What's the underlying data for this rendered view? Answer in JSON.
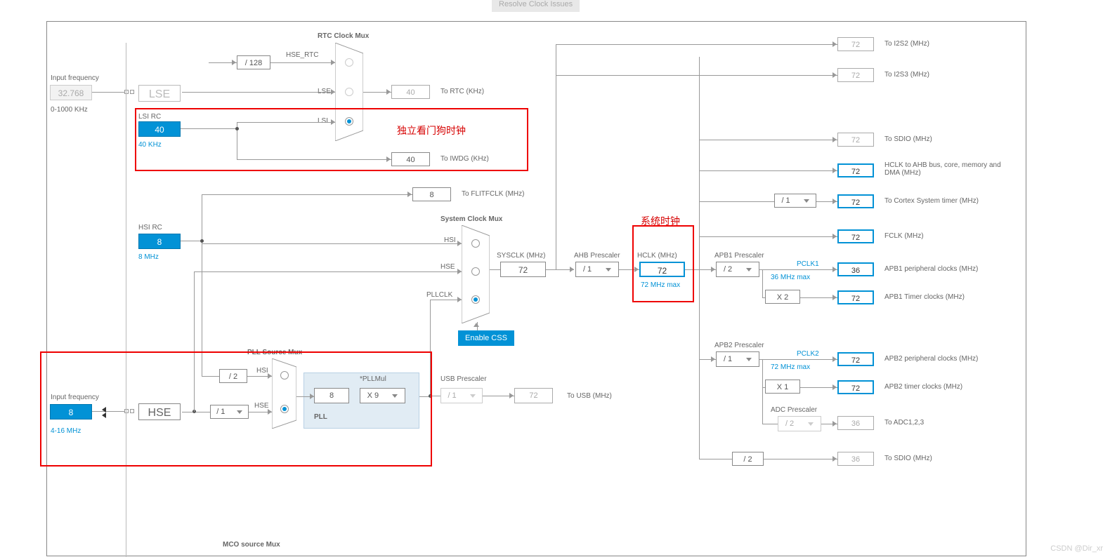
{
  "toolbar": {
    "resolve": "Resolve Clock Issues"
  },
  "input_freq_lse_label": "Input frequency",
  "input_freq_lse_value": "32.768",
  "input_freq_lse_range": "0-1000 KHz",
  "input_freq_hse_label": "Input frequency",
  "input_freq_hse_value": "8",
  "input_freq_hse_range": "4-16 MHz",
  "lse": {
    "label": "LSE"
  },
  "hse": {
    "label": "HSE"
  },
  "lsi": {
    "label": "LSI RC",
    "value": "40",
    "unit": "40 KHz"
  },
  "hsi": {
    "label": "HSI RC",
    "value": "8",
    "unit": "8 MHz"
  },
  "rtc_mux": {
    "title": "RTC Clock Mux",
    "div128": "/ 128",
    "hse_rtc": "HSE_RTC",
    "lse": "LSE",
    "lsi": "LSI",
    "out_value": "40",
    "out_label": "To RTC (KHz)"
  },
  "iwdg": {
    "value": "40",
    "label": "To IWDG (KHz)"
  },
  "flitf": {
    "value": "8",
    "label": "To FLITFCLK (MHz)"
  },
  "sys_mux": {
    "title": "System Clock Mux",
    "hsi": "HSI",
    "hse": "HSE",
    "pllclk": "PLLCLK"
  },
  "css_btn": "Enable CSS",
  "pll_src_mux": {
    "title": "PLL Source Mux",
    "hsi": "HSI",
    "hse": "HSE",
    "div2": "/ 2",
    "div1": "/ 1"
  },
  "pll": {
    "title": "PLL",
    "value": "8",
    "mul_label": "*PLLMul",
    "mul": "X 9"
  },
  "usb": {
    "title": "USB Prescaler",
    "div": "/ 1",
    "value": "72",
    "label": "To USB (MHz)"
  },
  "sysclk": {
    "label": "SYSCLK (MHz)",
    "value": "72"
  },
  "ahb": {
    "title": "AHB Prescaler",
    "div": "/ 1"
  },
  "hclk": {
    "label": "HCLK (MHz)",
    "value": "72",
    "max": "72 MHz max"
  },
  "apb1": {
    "title": "APB1 Prescaler",
    "div": "/ 2",
    "pclk1": "PCLK1",
    "pclk1_max": "36 MHz max",
    "x2": "X 2"
  },
  "apb2": {
    "title": "APB2 Prescaler",
    "div": "/ 1",
    "pclk2": "PCLK2",
    "pclk2_max": "72 MHz max",
    "x1": "X 1"
  },
  "adc": {
    "title": "ADC Prescaler",
    "div": "/ 2"
  },
  "sys_div1": "/ 1",
  "sdio_div": "/ 2",
  "outputs": {
    "i2s2": {
      "v": "72",
      "l": "To I2S2 (MHz)"
    },
    "i2s3": {
      "v": "72",
      "l": "To I2S3 (MHz)"
    },
    "sdio": {
      "v": "72",
      "l": "To SDIO (MHz)"
    },
    "hclk_ahb": {
      "v": "72",
      "l": "HCLK to AHB bus, core, memory and DMA (MHz)"
    },
    "cortex": {
      "v": "72",
      "l": "To Cortex System timer (MHz)"
    },
    "fclk": {
      "v": "72",
      "l": "FCLK (MHz)"
    },
    "apb1_periph": {
      "v": "36",
      "l": "APB1 peripheral clocks (MHz)"
    },
    "apb1_timer": {
      "v": "72",
      "l": "APB1 Timer clocks (MHz)"
    },
    "apb2_periph": {
      "v": "72",
      "l": "APB2 peripheral clocks (MHz)"
    },
    "apb2_timer": {
      "v": "72",
      "l": "APB2 timer clocks (MHz)"
    },
    "adc": {
      "v": "36",
      "l": "To ADC1,2,3"
    },
    "sdio2": {
      "v": "36",
      "l": "To SDIO (MHz)"
    }
  },
  "annotations": {
    "iwdg_zh": "独立看门狗时钟",
    "sysclk_zh": "系统时钟"
  },
  "mco": "MCO source Mux",
  "watermark": "CSDN @Dir_xr"
}
